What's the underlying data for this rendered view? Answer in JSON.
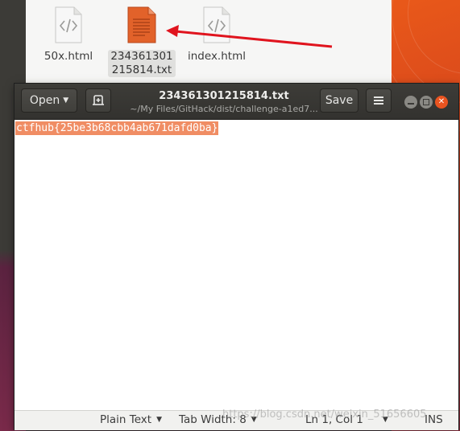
{
  "files": [
    {
      "name": "50x.html",
      "icon": "html-file-icon"
    },
    {
      "name_line1": "234361301",
      "name_line2": "215814.txt",
      "icon": "text-file-icon",
      "selected": true
    },
    {
      "name": "index.html",
      "icon": "html-file-icon"
    }
  ],
  "annotation": {
    "arrow_color": "#e0141e"
  },
  "gedit": {
    "open_label": "Open",
    "title": "234361301215814.txt",
    "subtitle": "~/My Files/GitHack/dist/challenge-a1ed7...",
    "save_label": "Save",
    "content": "ctfhub{25be3b68cbb4ab671dafd0ba}"
  },
  "statusbar": {
    "language": "Plain Text",
    "tab_width": "Tab Width: 8",
    "position": "Ln 1, Col 1",
    "mode": "INS"
  },
  "watermark": "https://blog.csdn.net/weixin_51656605",
  "colors": {
    "selection": "#f08d64",
    "headerbar": "#3d3c38",
    "close_button": "#e95420"
  }
}
